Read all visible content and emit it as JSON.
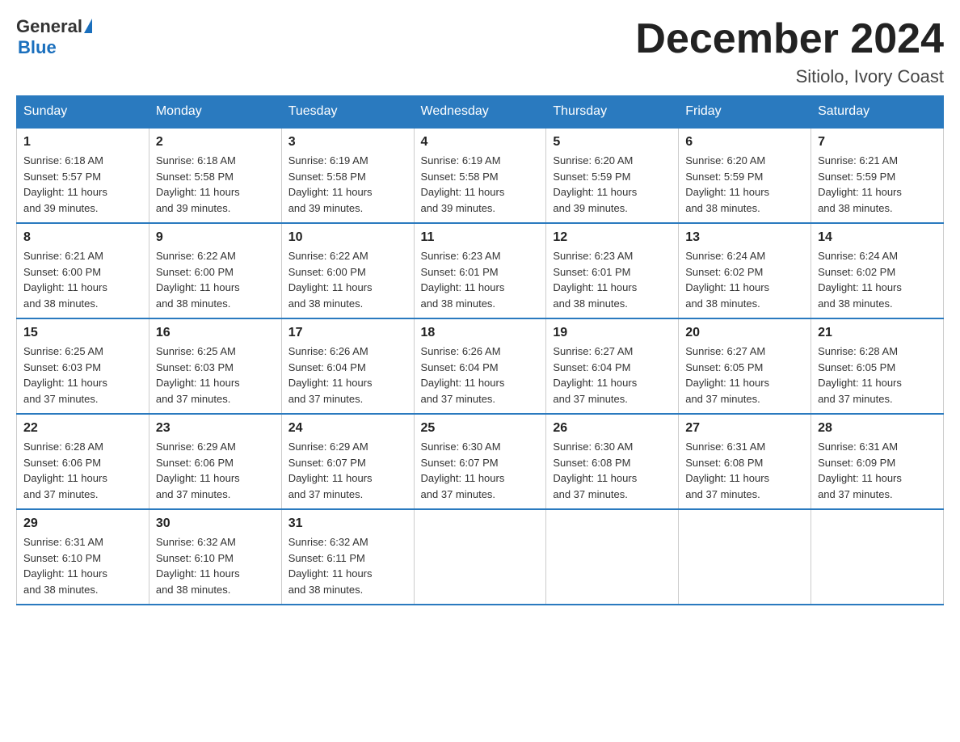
{
  "logo": {
    "general": "General",
    "blue": "Blue"
  },
  "title": {
    "month_year": "December 2024",
    "location": "Sitiolo, Ivory Coast"
  },
  "headers": [
    "Sunday",
    "Monday",
    "Tuesday",
    "Wednesday",
    "Thursday",
    "Friday",
    "Saturday"
  ],
  "weeks": [
    [
      {
        "day": "1",
        "sunrise": "6:18 AM",
        "sunset": "5:57 PM",
        "daylight": "11 hours and 39 minutes."
      },
      {
        "day": "2",
        "sunrise": "6:18 AM",
        "sunset": "5:58 PM",
        "daylight": "11 hours and 39 minutes."
      },
      {
        "day": "3",
        "sunrise": "6:19 AM",
        "sunset": "5:58 PM",
        "daylight": "11 hours and 39 minutes."
      },
      {
        "day": "4",
        "sunrise": "6:19 AM",
        "sunset": "5:58 PM",
        "daylight": "11 hours and 39 minutes."
      },
      {
        "day": "5",
        "sunrise": "6:20 AM",
        "sunset": "5:59 PM",
        "daylight": "11 hours and 39 minutes."
      },
      {
        "day": "6",
        "sunrise": "6:20 AM",
        "sunset": "5:59 PM",
        "daylight": "11 hours and 38 minutes."
      },
      {
        "day": "7",
        "sunrise": "6:21 AM",
        "sunset": "5:59 PM",
        "daylight": "11 hours and 38 minutes."
      }
    ],
    [
      {
        "day": "8",
        "sunrise": "6:21 AM",
        "sunset": "6:00 PM",
        "daylight": "11 hours and 38 minutes."
      },
      {
        "day": "9",
        "sunrise": "6:22 AM",
        "sunset": "6:00 PM",
        "daylight": "11 hours and 38 minutes."
      },
      {
        "day": "10",
        "sunrise": "6:22 AM",
        "sunset": "6:00 PM",
        "daylight": "11 hours and 38 minutes."
      },
      {
        "day": "11",
        "sunrise": "6:23 AM",
        "sunset": "6:01 PM",
        "daylight": "11 hours and 38 minutes."
      },
      {
        "day": "12",
        "sunrise": "6:23 AM",
        "sunset": "6:01 PM",
        "daylight": "11 hours and 38 minutes."
      },
      {
        "day": "13",
        "sunrise": "6:24 AM",
        "sunset": "6:02 PM",
        "daylight": "11 hours and 38 minutes."
      },
      {
        "day": "14",
        "sunrise": "6:24 AM",
        "sunset": "6:02 PM",
        "daylight": "11 hours and 38 minutes."
      }
    ],
    [
      {
        "day": "15",
        "sunrise": "6:25 AM",
        "sunset": "6:03 PM",
        "daylight": "11 hours and 37 minutes."
      },
      {
        "day": "16",
        "sunrise": "6:25 AM",
        "sunset": "6:03 PM",
        "daylight": "11 hours and 37 minutes."
      },
      {
        "day": "17",
        "sunrise": "6:26 AM",
        "sunset": "6:04 PM",
        "daylight": "11 hours and 37 minutes."
      },
      {
        "day": "18",
        "sunrise": "6:26 AM",
        "sunset": "6:04 PM",
        "daylight": "11 hours and 37 minutes."
      },
      {
        "day": "19",
        "sunrise": "6:27 AM",
        "sunset": "6:04 PM",
        "daylight": "11 hours and 37 minutes."
      },
      {
        "day": "20",
        "sunrise": "6:27 AM",
        "sunset": "6:05 PM",
        "daylight": "11 hours and 37 minutes."
      },
      {
        "day": "21",
        "sunrise": "6:28 AM",
        "sunset": "6:05 PM",
        "daylight": "11 hours and 37 minutes."
      }
    ],
    [
      {
        "day": "22",
        "sunrise": "6:28 AM",
        "sunset": "6:06 PM",
        "daylight": "11 hours and 37 minutes."
      },
      {
        "day": "23",
        "sunrise": "6:29 AM",
        "sunset": "6:06 PM",
        "daylight": "11 hours and 37 minutes."
      },
      {
        "day": "24",
        "sunrise": "6:29 AM",
        "sunset": "6:07 PM",
        "daylight": "11 hours and 37 minutes."
      },
      {
        "day": "25",
        "sunrise": "6:30 AM",
        "sunset": "6:07 PM",
        "daylight": "11 hours and 37 minutes."
      },
      {
        "day": "26",
        "sunrise": "6:30 AM",
        "sunset": "6:08 PM",
        "daylight": "11 hours and 37 minutes."
      },
      {
        "day": "27",
        "sunrise": "6:31 AM",
        "sunset": "6:08 PM",
        "daylight": "11 hours and 37 minutes."
      },
      {
        "day": "28",
        "sunrise": "6:31 AM",
        "sunset": "6:09 PM",
        "daylight": "11 hours and 37 minutes."
      }
    ],
    [
      {
        "day": "29",
        "sunrise": "6:31 AM",
        "sunset": "6:10 PM",
        "daylight": "11 hours and 38 minutes."
      },
      {
        "day": "30",
        "sunrise": "6:32 AM",
        "sunset": "6:10 PM",
        "daylight": "11 hours and 38 minutes."
      },
      {
        "day": "31",
        "sunrise": "6:32 AM",
        "sunset": "6:11 PM",
        "daylight": "11 hours and 38 minutes."
      },
      null,
      null,
      null,
      null
    ]
  ],
  "labels": {
    "sunrise": "Sunrise:",
    "sunset": "Sunset:",
    "daylight": "Daylight:"
  }
}
